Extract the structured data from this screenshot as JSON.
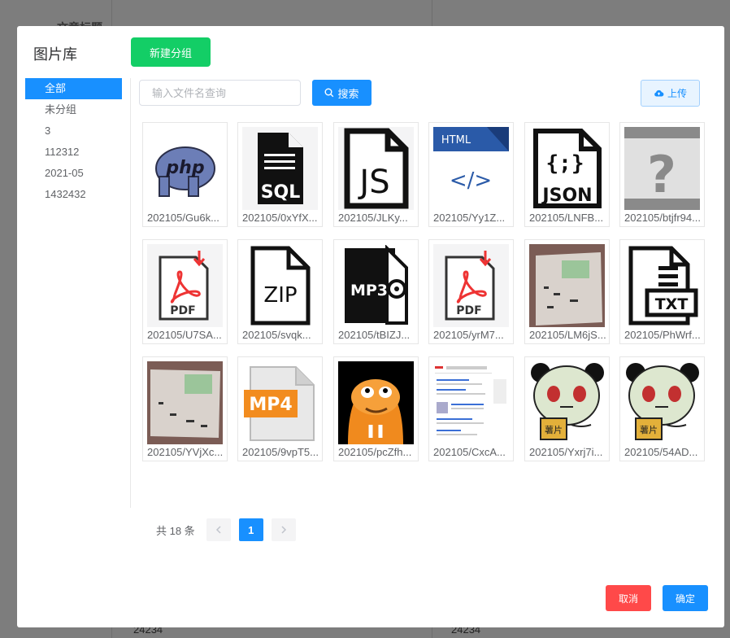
{
  "background": {
    "title": "文章标题",
    "cells": [
      "24234",
      "24234"
    ]
  },
  "modal": {
    "title": "图片库",
    "new_group_label": "新建分组",
    "search_placeholder": "输入文件名查询",
    "search_label": "搜索",
    "upload_label": "上传",
    "cancel_label": "取消",
    "confirm_label": "确定"
  },
  "sidebar": {
    "items": [
      {
        "label": "全部",
        "active": true
      },
      {
        "label": "未分组",
        "active": false
      },
      {
        "label": "3",
        "active": false
      },
      {
        "label": "112312",
        "active": false
      },
      {
        "label": "2021-05",
        "active": false
      },
      {
        "label": "1432432",
        "active": false
      }
    ]
  },
  "files": [
    {
      "name": "202105/Gu6k...",
      "icon": "php-icon"
    },
    {
      "name": "202105/0xYfX...",
      "icon": "sql-file-icon"
    },
    {
      "name": "202105/JLKy...",
      "icon": "js-file-icon"
    },
    {
      "name": "202105/Yy1Z...",
      "icon": "html-file-icon"
    },
    {
      "name": "202105/LNFB...",
      "icon": "json-file-icon"
    },
    {
      "name": "202105/btjfr94...",
      "icon": "unknown-file-icon"
    },
    {
      "name": "202105/U7SA...",
      "icon": "pdf-file-icon"
    },
    {
      "name": "202105/svqk...",
      "icon": "zip-file-icon"
    },
    {
      "name": "202105/tBIZJ...",
      "icon": "mp3-file-icon"
    },
    {
      "name": "202105/yrM7...",
      "icon": "pdf-file-icon"
    },
    {
      "name": "202105/LM6jS...",
      "icon": "photo-document-image"
    },
    {
      "name": "202105/PhWrf...",
      "icon": "txt-file-icon"
    },
    {
      "name": "202105/YVjXc...",
      "icon": "photo-document-image"
    },
    {
      "name": "202105/9vpT5...",
      "icon": "mp4-file-icon"
    },
    {
      "name": "202105/pcZfh...",
      "icon": "cartoon-image"
    },
    {
      "name": "202105/CxcA...",
      "icon": "screenshot-image"
    },
    {
      "name": "202105/Yxrj7i...",
      "icon": "panda-meme-image"
    },
    {
      "name": "202105/54AD...",
      "icon": "panda-meme-image"
    }
  ],
  "pagination": {
    "total_label": "共 18 条",
    "current_page": "1",
    "prev_icon": "chevron-left-icon",
    "next_icon": "chevron-right-icon"
  },
  "icon_text": {
    "php": "php",
    "sql": "SQL",
    "js": "JS",
    "html": "HTML",
    "html_tag": "</>",
    "json_braces": "{;}",
    "json": "JSON",
    "unknown": "?",
    "pdf": "PDF",
    "zip": "ZIP",
    "mp3": "MP3",
    "txt": "TXT",
    "mp4": "MP4",
    "meme_sign": "薯片"
  },
  "colors": {
    "primary": "#1890ff",
    "success": "#13ce66",
    "danger": "#ff4949"
  }
}
